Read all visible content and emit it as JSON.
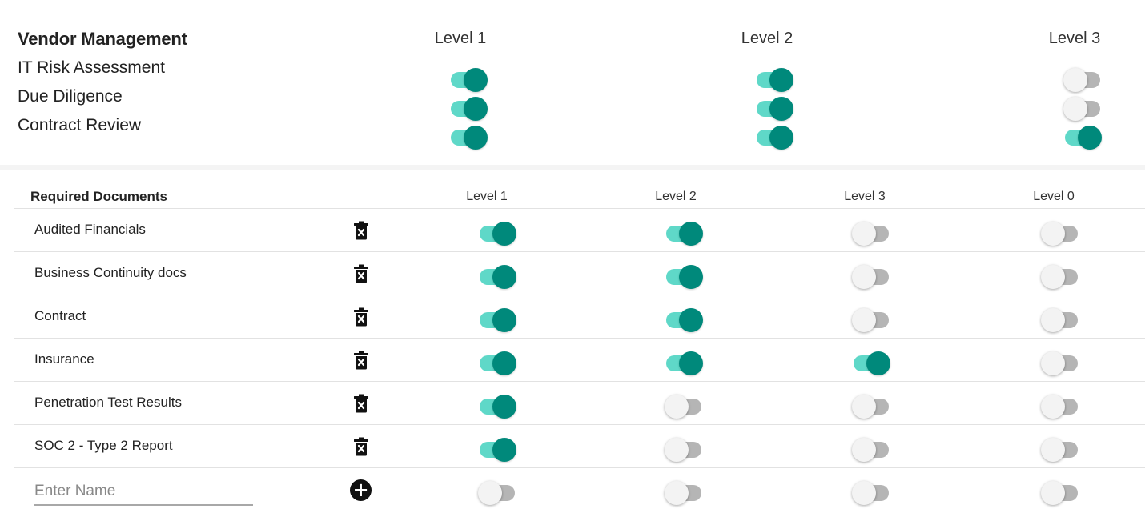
{
  "vendor": {
    "title": "Vendor Management",
    "levels": [
      "Level 1",
      "Level 2",
      "Level 3"
    ],
    "rows": [
      {
        "label": "IT Risk Assessment",
        "toggles": [
          true,
          true,
          false
        ]
      },
      {
        "label": "Due Diligence",
        "toggles": [
          true,
          true,
          false
        ]
      },
      {
        "label": "Contract Review",
        "toggles": [
          true,
          true,
          true
        ]
      }
    ]
  },
  "documents": {
    "title": "Required Documents",
    "levels": [
      "Level 1",
      "Level 2",
      "Level 3",
      "Level 0"
    ],
    "rows": [
      {
        "name": "Audited Financials",
        "toggles": [
          true,
          true,
          false,
          false
        ]
      },
      {
        "name": "Business Continuity docs",
        "toggles": [
          true,
          true,
          false,
          false
        ]
      },
      {
        "name": "Contract",
        "toggles": [
          true,
          true,
          false,
          false
        ]
      },
      {
        "name": "Insurance",
        "toggles": [
          true,
          true,
          true,
          false
        ]
      },
      {
        "name": "Penetration Test Results",
        "toggles": [
          true,
          false,
          false,
          false
        ]
      },
      {
        "name": "SOC 2 - Type 2 Report",
        "toggles": [
          true,
          false,
          false,
          false
        ]
      }
    ],
    "new_row": {
      "placeholder": "Enter Name",
      "value": "",
      "toggles": [
        false,
        false,
        false,
        false
      ]
    }
  },
  "colors": {
    "toggle_on_thumb": "#00897b",
    "toggle_on_track": "#5fd8c8",
    "toggle_off_thumb": "#f3f3f3",
    "toggle_off_track": "#b5b5b5"
  },
  "icons": {
    "delete": "trash-x-icon",
    "add": "plus-circle-icon"
  }
}
